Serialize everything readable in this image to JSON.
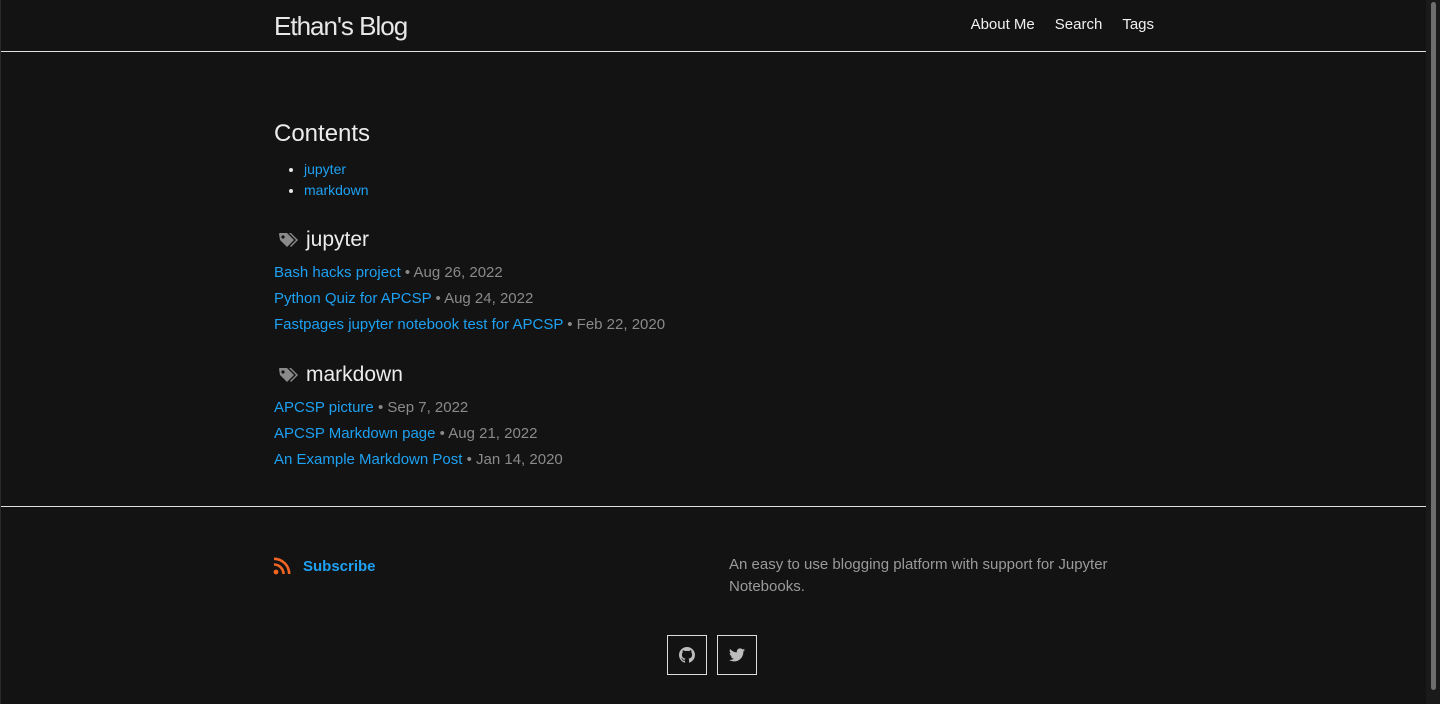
{
  "header": {
    "site_title": "Ethan's Blog",
    "nav": [
      "About Me",
      "Search",
      "Tags"
    ]
  },
  "contents": {
    "title": "Contents",
    "items": [
      "jupyter",
      "markdown"
    ]
  },
  "tags": [
    {
      "name": "jupyter",
      "posts": [
        {
          "title": "Bash hacks project",
          "date": "• Aug 26, 2022"
        },
        {
          "title": "Python Quiz for APCSP",
          "date": "• Aug 24, 2022"
        },
        {
          "title": "Fastpages jupyter notebook test for APCSP",
          "date": "• Feb 22, 2020"
        }
      ]
    },
    {
      "name": "markdown",
      "posts": [
        {
          "title": "APCSP picture",
          "date": "• Sep 7, 2022"
        },
        {
          "title": "APCSP Markdown page",
          "date": "• Aug 21, 2022"
        },
        {
          "title": "An Example Markdown Post",
          "date": "• Jan 14, 2020"
        }
      ]
    }
  ],
  "footer": {
    "subscribe_label": "Subscribe",
    "description": "An easy to use blogging platform with support for Jupyter Notebooks.",
    "social": [
      {
        "icon": "github-icon"
      },
      {
        "icon": "twitter-icon"
      }
    ]
  },
  "colors": {
    "background": "#131313",
    "link": "#1ea1f2",
    "meta": "#8a8a8a",
    "rss": "#f26522"
  }
}
